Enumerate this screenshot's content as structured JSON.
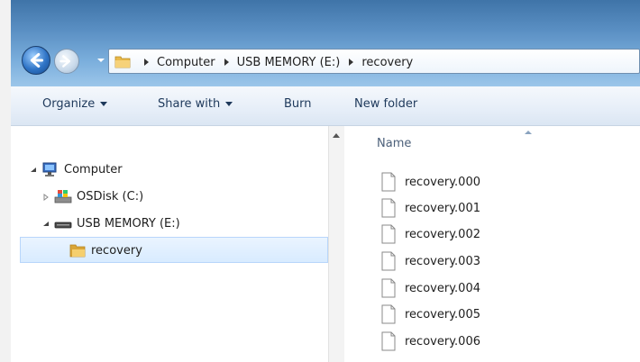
{
  "address_bar": {
    "crumbs": [
      "Computer",
      "USB MEMORY (E:)",
      "recovery"
    ]
  },
  "toolbar": {
    "organize": "Organize",
    "share_with": "Share with",
    "burn": "Burn",
    "new_folder": "New folder"
  },
  "nav_tree": {
    "computer": "Computer",
    "osdisk": "OSDisk (C:)",
    "usb": "USB MEMORY (E:)",
    "recovery": "recovery"
  },
  "content": {
    "column_name": "Name",
    "files": [
      "recovery.000",
      "recovery.001",
      "recovery.002",
      "recovery.003",
      "recovery.004",
      "recovery.005",
      "recovery.006"
    ]
  },
  "colors": {
    "title_blue": "#3f74a8",
    "selection": "#d8ebff",
    "folder": "#e8b94a"
  },
  "icons": [
    "back-arrow-icon",
    "forward-arrow-icon",
    "folder-icon",
    "computer-icon",
    "drive-icon",
    "usb-drive-icon",
    "file-icon"
  ]
}
